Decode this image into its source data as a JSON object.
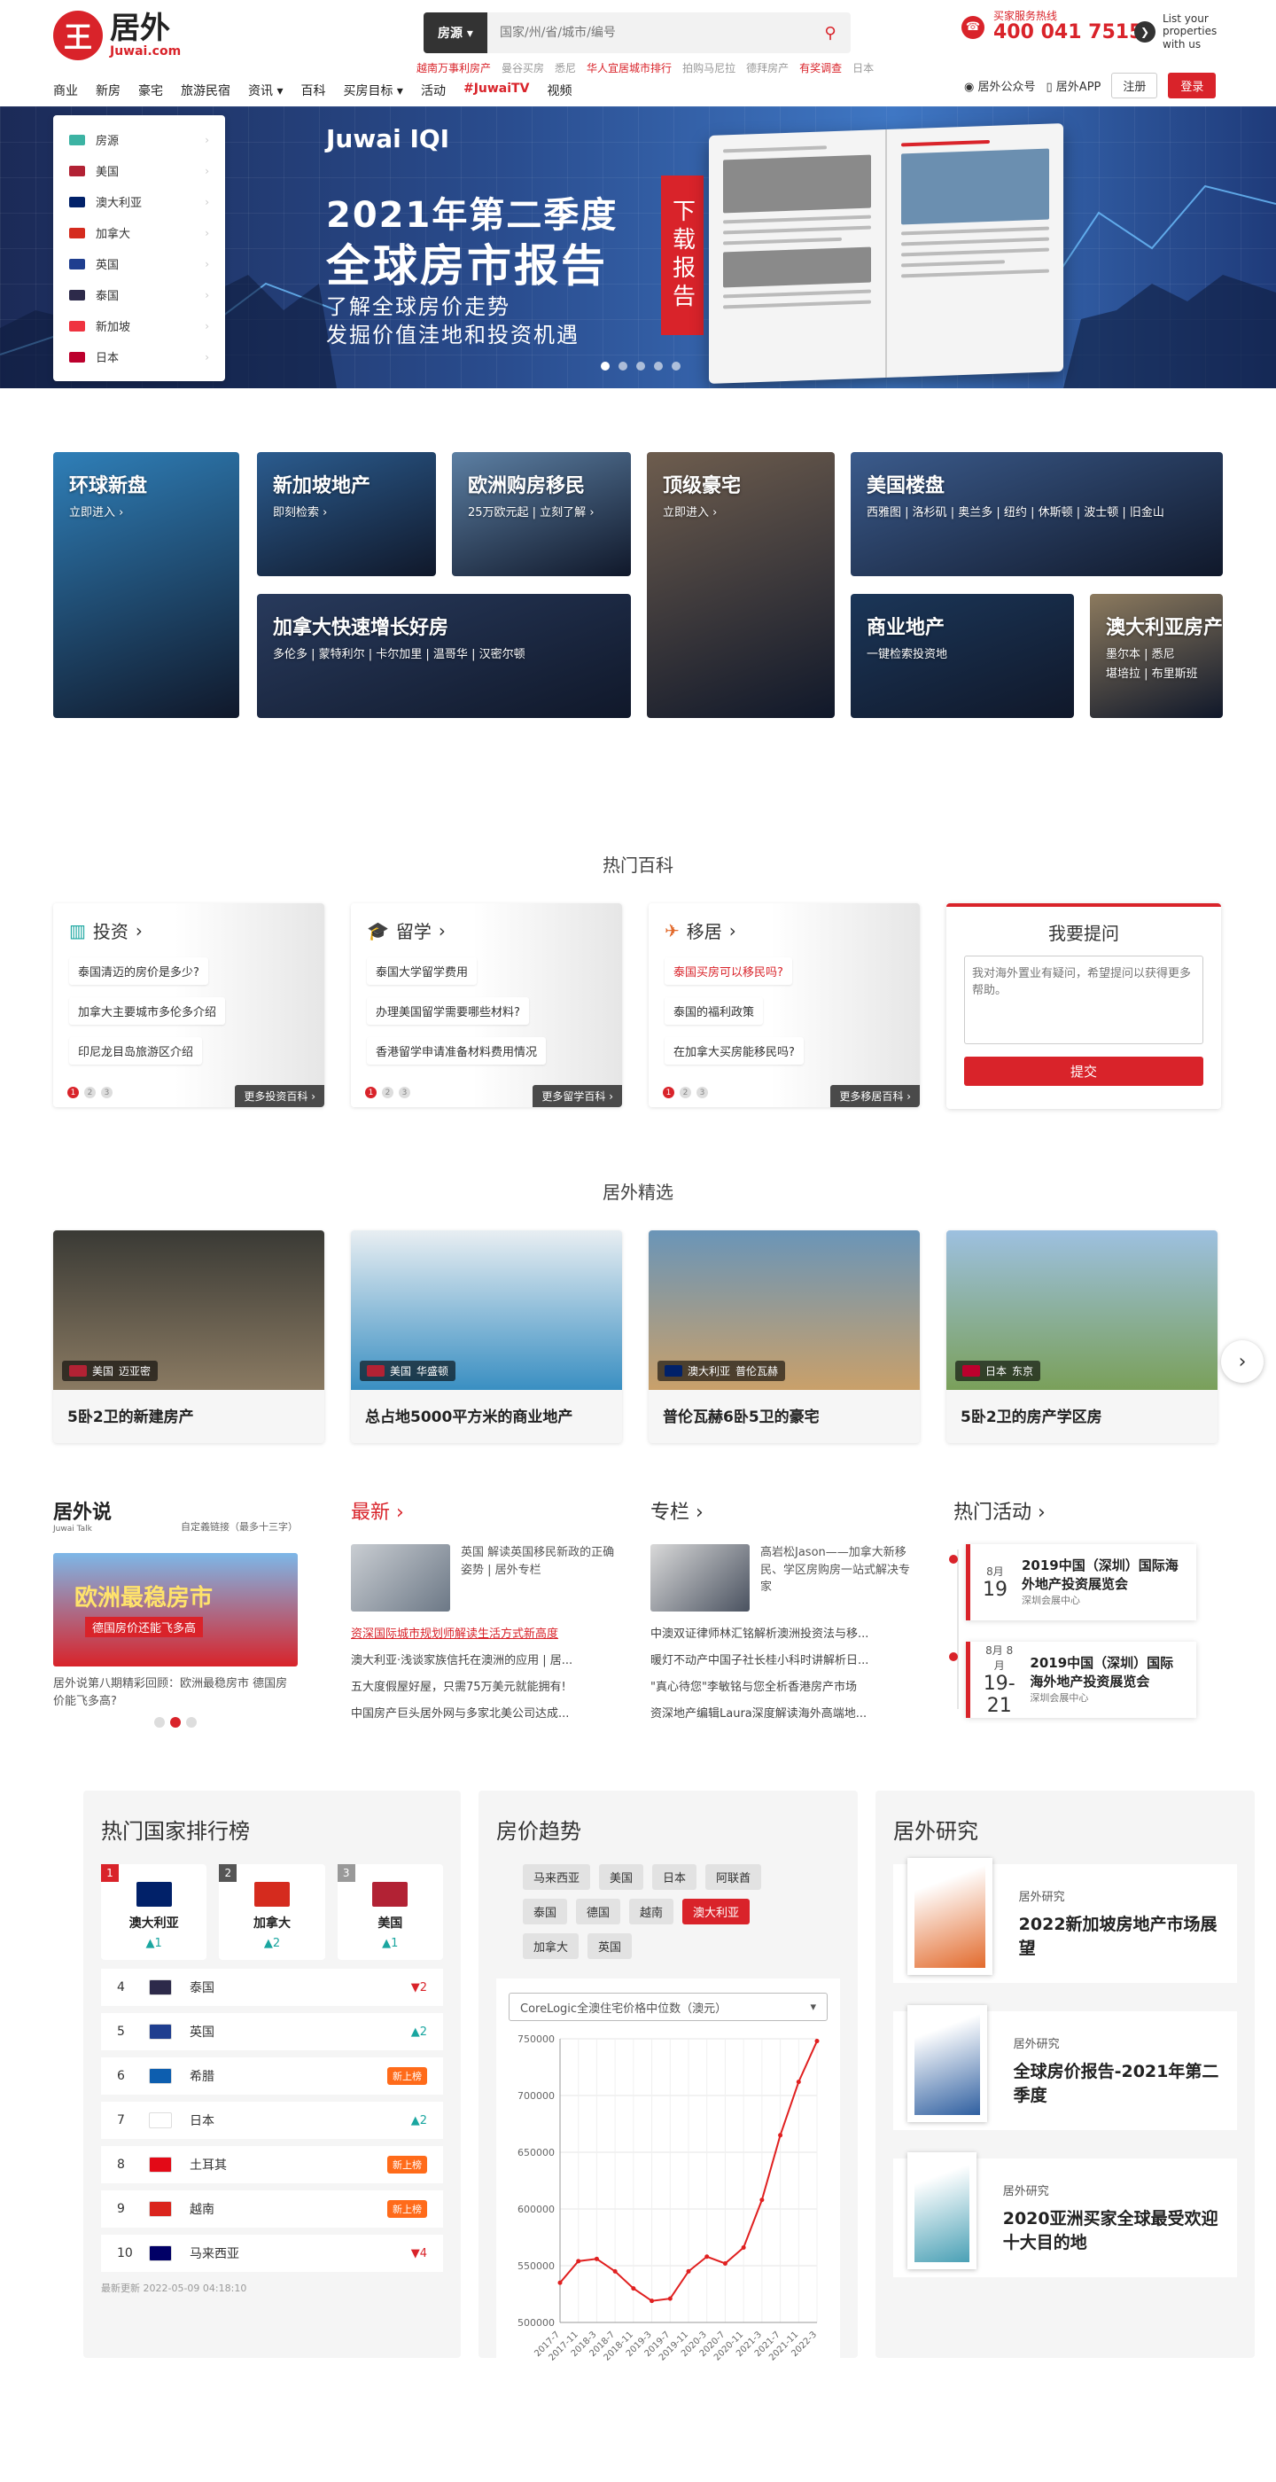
{
  "header": {
    "logo_cn": "居外",
    "logo_en": "Juwai.com",
    "search_select": "房源 ▾",
    "search_placeholder": "国家/州/省/城市/编号",
    "hot_links": [
      {
        "text": "越南万事利房产",
        "red": true
      },
      {
        "text": "曼谷买房",
        "red": false
      },
      {
        "text": "悉尼",
        "red": false
      },
      {
        "text": "华人宜居城市排行",
        "red": true
      },
      {
        "text": "拍购马尼拉",
        "red": false
      },
      {
        "text": "德拜房产",
        "red": false
      },
      {
        "text": "有奖调查",
        "red": true
      },
      {
        "text": "日本",
        "red": false
      }
    ],
    "hotline_label": "买家服务热线",
    "hotline_number": "400 041 7515",
    "list_property": "List your properties with us",
    "nav": [
      "商业",
      "新房",
      "豪宅",
      "旅游民宿",
      "资讯 ▾",
      "百科",
      "买房目标 ▾",
      "活动",
      "#JuwaiTV",
      "视频"
    ],
    "wechat": "居外公众号",
    "app": "居外APP",
    "register": "注册",
    "login": "登录"
  },
  "banner": {
    "categories": [
      {
        "label": "房源",
        "color": "#3cb3a3"
      },
      {
        "label": "美国",
        "color": "#b22234"
      },
      {
        "label": "澳大利亚",
        "color": "#012169"
      },
      {
        "label": "加拿大",
        "color": "#d52b1e"
      },
      {
        "label": "英国",
        "color": "#1f3e8f"
      },
      {
        "label": "泰国",
        "color": "#2d2a4a"
      },
      {
        "label": "新加坡",
        "color": "#ef3340"
      },
      {
        "label": "日本",
        "color": "#bc002d"
      }
    ],
    "brand": "Juwai IQI",
    "title1": "2021年第二季度",
    "title2": "全球房市报告",
    "sub1": "了解全球房价走势",
    "sub2": "发掘价值洼地和投资机遇",
    "download": "下载报告",
    "slide_index": 1,
    "slide_count": 5
  },
  "tiles": [
    {
      "title": "环球新盘",
      "sub": "立即进入 ›",
      "color": "#2f7fb8"
    },
    {
      "title": "新加坡地产",
      "sub": "即刻检索 ›",
      "color": "#2b5c8f"
    },
    {
      "title": "欧洲购房移民",
      "sub": "25万欧元起 | 立刻了解 ›",
      "color": "#5c7fa3"
    },
    {
      "title": "加拿大快速增长好房",
      "sub": "多伦多 | 蒙特利尔 | 卡尔加里 | 温哥华 | 汉密尔顿",
      "color": "#283a5c"
    },
    {
      "title": "顶级豪宅",
      "sub": "立即进入 ›",
      "color": "#6e5d4e"
    },
    {
      "title": "美国楼盘",
      "sub": "西雅图 | 洛杉矶 | 奥兰多 | 纽约 | 休斯顿 | 波士顿 | 旧金山",
      "color": "#3b5b8c"
    },
    {
      "title": "商业地产",
      "sub": "一键检索投资地",
      "color": "#1b3658"
    },
    {
      "title": "澳大利亚房产",
      "sub": "墨尔本 | 悉尼\n堪培拉 | 布里斯班",
      "color": "#8c7a5e"
    }
  ],
  "baike": {
    "title": "热门百科",
    "cards": [
      {
        "icon": "bar-chart",
        "title": "投资",
        "items": [
          "泰国清迈的房价是多少?",
          "加拿大主要城市多伦多介绍",
          "印尼龙目岛旅游区介绍"
        ],
        "more": "更多投资百科 ›",
        "highlight": -1
      },
      {
        "icon": "graduation-cap",
        "title": "留学",
        "items": [
          "泰国大学留学费用",
          "办理美国留学需要哪些材料?",
          "香港留学申请准备材料费用情况"
        ],
        "more": "更多留学百科 ›",
        "highlight": -1
      },
      {
        "icon": "airplane",
        "title": "移居",
        "items": [
          "泰国买房可以移民吗?",
          "泰国的福利政策",
          "在加拿大买房能移民吗?"
        ],
        "more": "更多移居百科 ›",
        "highlight": 0
      }
    ],
    "ask_title": "我要提问",
    "ask_placeholder": "我对海外置业有疑问，希望提问以获得更多帮助。",
    "ask_submit": "提交"
  },
  "picks": {
    "title": "居外精选",
    "items": [
      {
        "country": "美国",
        "city": "迈亚密",
        "flag": "#b22234",
        "caption": "5卧2卫的新建房产",
        "c1": "#3a3a35",
        "c2": "#8a7a62"
      },
      {
        "country": "美国",
        "city": "华盛顿",
        "flag": "#b22234",
        "caption": "总占地5000平方米的商业地产",
        "c1": "#e8eef2",
        "c2": "#3a8fc2"
      },
      {
        "country": "澳大利亚",
        "city": "普伦瓦赫",
        "flag": "#012169",
        "caption": "普伦瓦赫6卧5卫的豪宅",
        "c1": "#6a95b8",
        "c2": "#c9a06a"
      },
      {
        "country": "日本",
        "city": "东京",
        "flag": "#bc002d",
        "caption": "5卧2卫的房产学区房",
        "c1": "#9dc0e0",
        "c2": "#7aa05a"
      }
    ]
  },
  "news": {
    "talk_brand": "居外说",
    "talk_sub": "Juwai Talk",
    "talk_note": "自定義链接（最多十三字）",
    "talk_banner1": "欧洲最稳房市",
    "talk_banner2": "德国房价还能飞多高",
    "talk_caption": "居外说第八期精彩回顾：欧洲最稳房市 德国房价能飞多高?",
    "latest_title": "最新 ›",
    "latest_feature": "英国 解读英国移民新政的正确姿势 | 居外专栏",
    "latest_items": [
      "资深国际城市规划师解读生活方式新高度",
      "澳大利亚·浅谈家族信托在澳洲的应用 | 居...",
      "五大度假屋好屋，只需75万美元就能拥有!",
      "中国房产巨头居外网与多家北美公司达成..."
    ],
    "column_title": "专栏 ›",
    "column_feature": "高岩松Jason——加拿大新移民、学区房购房一站式解决专家",
    "column_items": [
      "中澳双证律师林汇铭解析澳洲投资法与移...",
      "暖灯不动产中国子社长桂小科时讲解析日...",
      "\"真心待您\"李敏铭与您全析香港房产市场",
      "资深地产编辑Laura深度解读海外高端地..."
    ],
    "events_title": "热门活动 ›",
    "events": [
      {
        "month": "8月",
        "day": "19",
        "title": "2019中国（深圳）国际海外地产投资展览会",
        "loc": "深圳会展中心"
      },
      {
        "month": "8月   8月",
        "day": "19-21",
        "title": "2019中国（深圳）国际海外地产投资展览会",
        "loc": "深圳会展中心"
      }
    ]
  },
  "ranking": {
    "title": "热门国家排行榜",
    "top": [
      {
        "rank": "1",
        "name": "澳大利亚",
        "change": "▲1",
        "flag": "#012169",
        "rk": "#d9232a"
      },
      {
        "rank": "2",
        "name": "加拿大",
        "change": "▲2",
        "flag": "#d52b1e",
        "rk": "#555"
      },
      {
        "rank": "3",
        "name": "美国",
        "change": "▲1",
        "flag": "#b22234",
        "rk": "#999"
      }
    ],
    "rows": [
      {
        "rank": "4",
        "name": "泰国",
        "change": "▼2",
        "type": "dn",
        "flag": "#2d2a4a"
      },
      {
        "rank": "5",
        "name": "英国",
        "change": "▲2",
        "type": "up",
        "flag": "#1f3e8f"
      },
      {
        "rank": "6",
        "name": "希腊",
        "change": "新上榜",
        "type": "new",
        "flag": "#0d5eaf"
      },
      {
        "rank": "7",
        "name": "日本",
        "change": "▲2",
        "type": "up",
        "flag": "#ffffff"
      },
      {
        "rank": "8",
        "name": "土耳其",
        "change": "新上榜",
        "type": "new",
        "flag": "#e30a17"
      },
      {
        "rank": "9",
        "name": "越南",
        "change": "新上榜",
        "type": "new",
        "flag": "#da251d"
      },
      {
        "rank": "10",
        "name": "马来西亚",
        "change": "▼4",
        "type": "dn",
        "flag": "#010066"
      }
    ],
    "updated": "最新更新 2022-05-09 04:18:10"
  },
  "trend": {
    "title": "房价趋势",
    "countries": [
      "马来西亚",
      "美国",
      "日本",
      "阿联酋",
      "泰国",
      "德国",
      "越南",
      "澳大利亚",
      "加拿大",
      "英国"
    ],
    "selected": "澳大利亚",
    "select_label": "CoreLogic全澳住宅价格中位数（澳元）"
  },
  "chart_data": {
    "type": "line",
    "title": "",
    "xlabel": "",
    "ylabel": "",
    "ylim": [
      500000,
      750000
    ],
    "yticks": [
      500000,
      550000,
      600000,
      650000,
      700000,
      750000
    ],
    "x": [
      "2017-7",
      "2017-11",
      "2018-3",
      "2018-7",
      "2018-11",
      "2019-3",
      "2019-7",
      "2019-11",
      "2020-3",
      "2020-7",
      "2020-11",
      "2021-3",
      "2021-7",
      "2021-11",
      "2022-3"
    ],
    "series": [
      {
        "color": "#e02020",
        "values": [
          535000,
          554000,
          556000,
          545000,
          530000,
          519000,
          521000,
          545000,
          558000,
          552000,
          566000,
          608000,
          665000,
          712000,
          748000
        ]
      }
    ]
  },
  "research": {
    "title": "居外研究",
    "items": [
      {
        "label": "居外研究",
        "title": "2022新加坡房地产市场展望",
        "c": "#e26a2c"
      },
      {
        "label": "居外研究",
        "title": "全球房价报告-2021年第二季度",
        "c": "#2f5fa0"
      },
      {
        "label": "居外研究",
        "title": "2020亚洲买家全球最受欢迎十大目的地",
        "c": "#4aa0b5"
      }
    ]
  }
}
